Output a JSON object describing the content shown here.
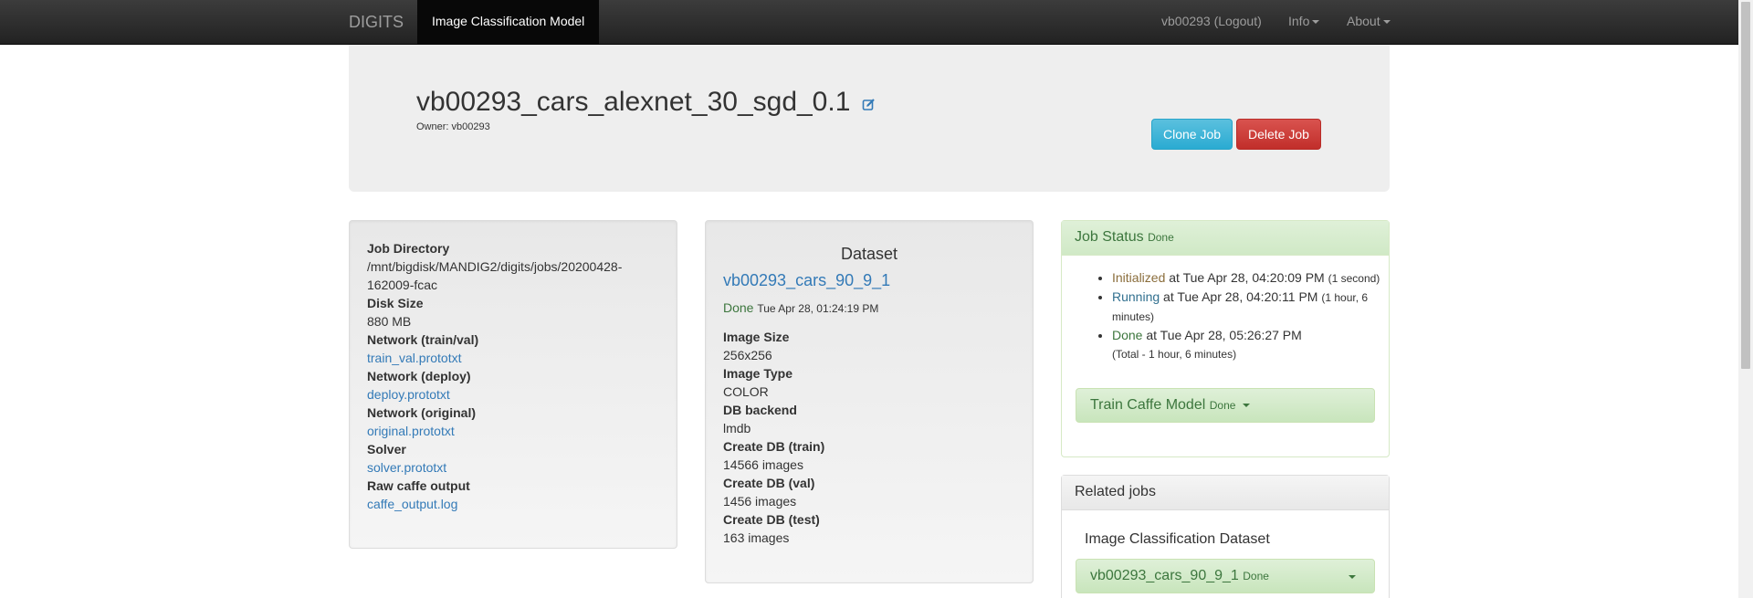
{
  "nav": {
    "brand": "DIGITS",
    "active": "Image Classification Model",
    "user": "vb00293 (Logout)",
    "info": "Info",
    "about": "About"
  },
  "job": {
    "title": "vb00293_cars_alexnet_30_sgd_0.1",
    "owner": "Owner: vb00293",
    "clone_label": "Clone Job",
    "delete_label": "Delete Job"
  },
  "details": {
    "items": [
      {
        "label": "Job Directory",
        "value": "/mnt/bigdisk/MANDIG2/digits/jobs/20200428-162009-fcac",
        "link": false
      },
      {
        "label": "Disk Size",
        "value": "880 MB",
        "link": false
      },
      {
        "label": "Network (train/val)",
        "value": "train_val.prototxt",
        "link": true
      },
      {
        "label": "Network (deploy)",
        "value": "deploy.prototxt",
        "link": true
      },
      {
        "label": "Network (original)",
        "value": "original.prototxt",
        "link": true
      },
      {
        "label": "Solver",
        "value": "solver.prototxt",
        "link": true
      },
      {
        "label": "Raw caffe output",
        "value": "caffe_output.log",
        "link": true
      }
    ]
  },
  "dataset": {
    "heading": "Dataset",
    "name": "vb00293_cars_90_9_1",
    "status": "Done",
    "status_time": "Tue Apr 28, 01:24:19 PM",
    "items": [
      {
        "label": "Image Size",
        "value": "256x256"
      },
      {
        "label": "Image Type",
        "value": "COLOR"
      },
      {
        "label": "DB backend",
        "value": "lmdb"
      },
      {
        "label": "Create DB (train)",
        "value": "14566 images"
      },
      {
        "label": "Create DB (val)",
        "value": "1456 images"
      },
      {
        "label": "Create DB (test)",
        "value": "163 images"
      }
    ]
  },
  "job_status": {
    "heading": "Job Status",
    "heading_state": "Done",
    "init_word": "Initialized",
    "init_time": " at Tue Apr 28, 04:20:09 PM ",
    "init_dur": "(1 second)",
    "run_word": "Running",
    "run_time": " at Tue Apr 28, 04:20:11 PM ",
    "run_dur": "(1 hour, 6 minutes)",
    "done_word": "Done",
    "done_time": " at Tue Apr 28, 05:26:27 PM",
    "total": "(Total - 1 hour, 6 minutes)",
    "train_task": "Train Caffe Model",
    "train_state": "Done"
  },
  "related": {
    "heading": "Related jobs",
    "subheading": "Image Classification Dataset",
    "dataset_name": "vb00293_cars_90_9_1",
    "dataset_state": "Done"
  },
  "colors": {
    "navbar": "#222222",
    "link": "#337ab7",
    "success_text": "#3c763d",
    "clone_btn": "#5bc0de",
    "delete_btn": "#d9534f"
  }
}
